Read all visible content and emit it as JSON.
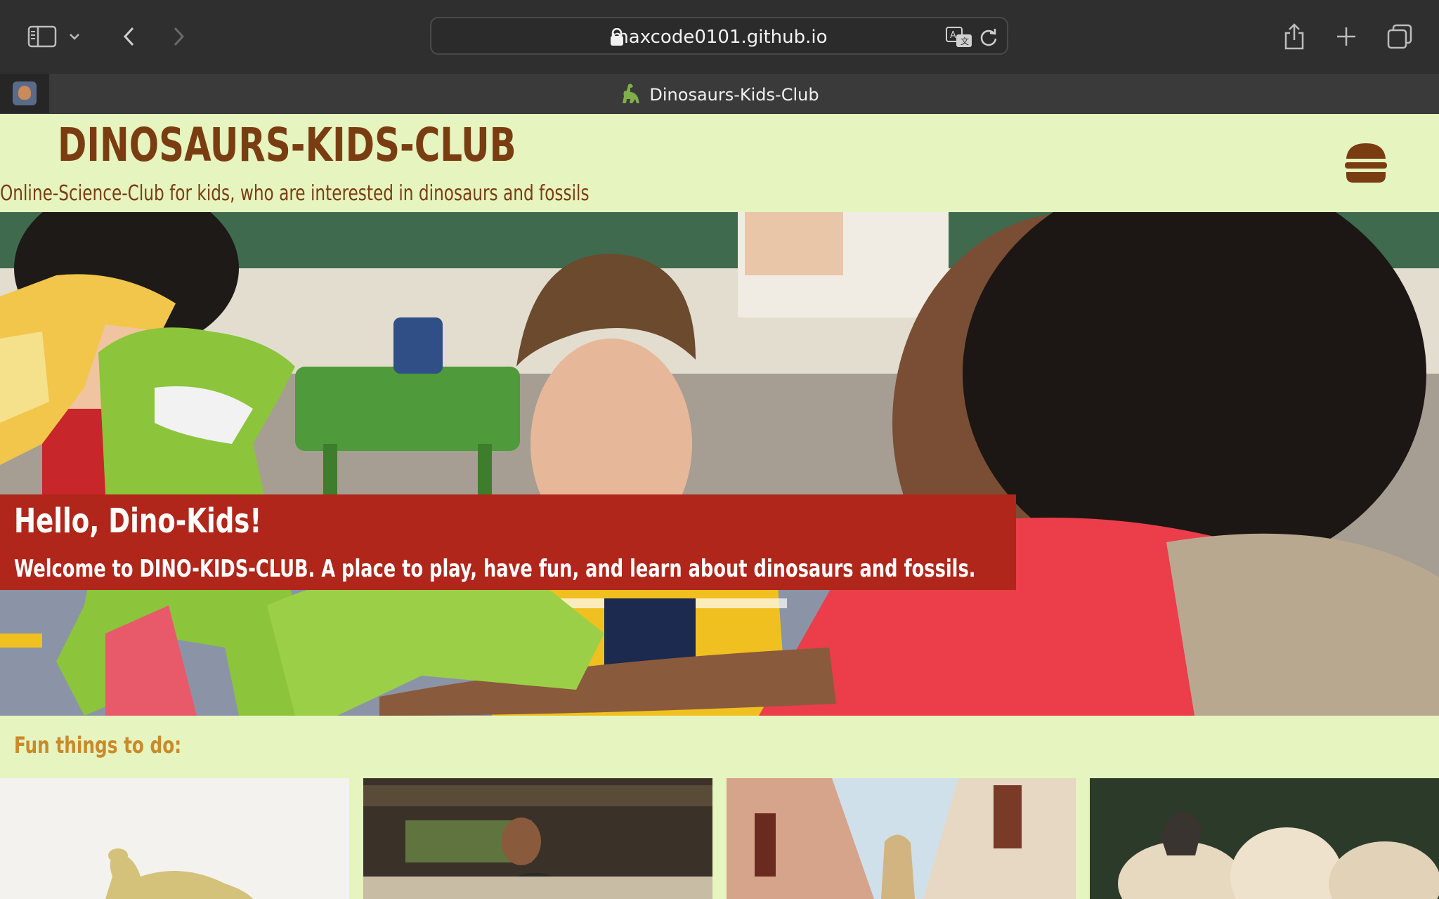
{
  "browser": {
    "url": "maxcode0101.github.io",
    "tab_title": "Dinosaurs-Kids-Club",
    "tab_favicon": "dinosaur-icon",
    "icons": [
      "sidebar-icon",
      "chevron-down-icon",
      "back-icon",
      "forward-icon",
      "lock-icon",
      "translate-icon",
      "reload-icon",
      "share-icon",
      "plus-icon",
      "tabs-overview-icon"
    ]
  },
  "header": {
    "title": "DINOSAURS-KIDS-CLUB",
    "subtitle": "Online-Science-Club for kids, who are interested in dinosaurs and fossils",
    "menu_icon": "hamburger-icon"
  },
  "hero": {
    "heading": "Hello, Dino-Kids!",
    "text": "Welcome to DINO-KIDS-CLUB. A place to play, have fun, and learn about dinosaurs and fossils."
  },
  "fun": {
    "heading": "Fun things to do:"
  },
  "colors": {
    "page_bg": "#e6f4bf",
    "brand_brown": "#7a3d12",
    "banner_red": "#b0261a",
    "accent_ochre": "#c98a2a",
    "chrome_dark": "#2f2f2f"
  }
}
